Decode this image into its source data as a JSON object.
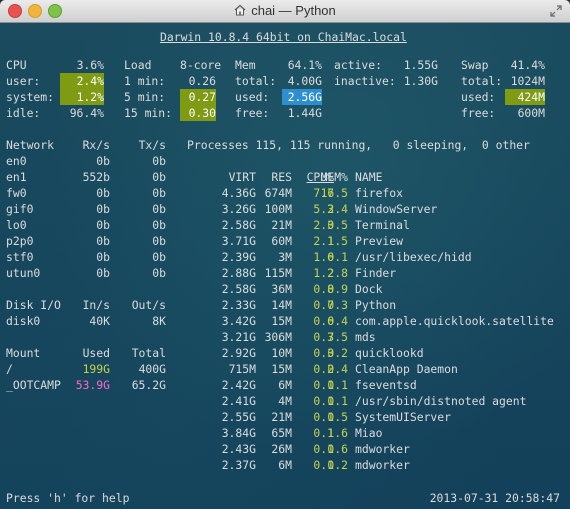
{
  "window": {
    "title": "chai — Python"
  },
  "header": {
    "host": "Darwin 10.8.4 64bit on ChaiMac.local"
  },
  "cpu": {
    "label": "CPU",
    "total": "3.6%",
    "user_label": "user:",
    "user": "2.4%",
    "system_label": "system:",
    "system": "1.2%",
    "idle_label": "idle:",
    "idle": "96.4%"
  },
  "load": {
    "label": "Load",
    "cores": "8-core",
    "m1_label": "1 min:",
    "m1": "0.26",
    "m5_label": "5 min:",
    "m5": "0.27",
    "m15_label": "15 min:",
    "m15": "0.30"
  },
  "mem": {
    "label": "Mem",
    "percent": "64.1%",
    "total_label": "total:",
    "total": "4.00G",
    "used_label": "used:",
    "used": "2.56G",
    "free_label": "free:",
    "free": "1.44G",
    "active_label": "active:",
    "active": "1.55G",
    "inactive_label": "inactive:",
    "inactive": "1.30G"
  },
  "swap": {
    "label": "Swap",
    "percent": "41.4%",
    "total_label": "total:",
    "total": "1024M",
    "used_label": "used:",
    "used": "424M",
    "free_label": "free:",
    "free": "600M"
  },
  "network": {
    "headers": [
      "Network",
      "Rx/s",
      "Tx/s"
    ],
    "rows": [
      [
        "en0",
        "0b",
        "0b"
      ],
      [
        "en1",
        "552b",
        "0b"
      ],
      [
        "fw0",
        "0b",
        "0b"
      ],
      [
        "gif0",
        "0b",
        "0b"
      ],
      [
        "lo0",
        "0b",
        "0b"
      ],
      [
        "p2p0",
        "0b",
        "0b"
      ],
      [
        "stf0",
        "0b",
        "0b"
      ],
      [
        "utun0",
        "0b",
        "0b"
      ]
    ]
  },
  "diskio": {
    "headers": [
      "Disk I/O",
      "In/s",
      "Out/s"
    ],
    "rows": [
      [
        "disk0",
        "40K",
        "8K"
      ]
    ]
  },
  "mounts": {
    "headers": [
      "Mount",
      "Used",
      "Total"
    ],
    "rows": [
      [
        "/",
        "199G",
        "400G"
      ],
      [
        "_OOTCAMP",
        "53.9G",
        "65.2G"
      ]
    ]
  },
  "processes": {
    "summary": "Processes 115, 115 running,   0 sleeping,  0 other",
    "headers": [
      "VIRT",
      "RES",
      "CPU%",
      "MEM%",
      "NAME"
    ],
    "rows": [
      [
        "4.36G",
        "674M",
        "7.7",
        "16.5",
        "firefox"
      ],
      [
        "3.26G",
        "100M",
        "5.3",
        "2.4",
        "WindowServer"
      ],
      [
        "2.58G",
        "21M",
        "2.3",
        "0.5",
        "Terminal"
      ],
      [
        "3.71G",
        "60M",
        "2.1",
        "1.5",
        "Preview"
      ],
      [
        "2.39G",
        "3M",
        "1.6",
        "0.1",
        "/usr/libexec/hidd"
      ],
      [
        "2.88G",
        "115M",
        "1.2",
        "2.8",
        "Finder"
      ],
      [
        "2.58G",
        "36M",
        "0.8",
        "0.9",
        "Dock"
      ],
      [
        "2.33G",
        "14M",
        "0.7",
        "0.3",
        "Python"
      ],
      [
        "3.42G",
        "15M",
        "0.6",
        "0.4",
        "com.apple.quicklook.satellite"
      ],
      [
        "3.21G",
        "306M",
        "0.3",
        "7.5",
        "mds"
      ],
      [
        "2.92G",
        "10M",
        "0.3",
        "0.2",
        "quicklookd"
      ],
      [
        "715M",
        "15M",
        "0.2",
        "0.4",
        "CleanApp Daemon"
      ],
      [
        "2.42G",
        "6M",
        "0.1",
        "0.1",
        "fseventsd"
      ],
      [
        "2.41G",
        "4M",
        "0.1",
        "0.1",
        "/usr/sbin/distnoted agent"
      ],
      [
        "2.55G",
        "21M",
        "0.1",
        "0.5",
        "SystemUIServer"
      ],
      [
        "3.84G",
        "65M",
        "0.1",
        "1.6",
        "Miao"
      ],
      [
        "2.43G",
        "26M",
        "0.1",
        "0.6",
        "mdworker"
      ],
      [
        "2.37G",
        "6M",
        "0.1",
        "0.2",
        "mdworker"
      ]
    ]
  },
  "footer": {
    "help": "Press 'h' for help",
    "datetime": "2013-07-31 20:58:47"
  },
  "colors": {
    "highlight_green": "#7f9b14",
    "highlight_blue": "#2e8fd0",
    "value_green": "#c7d44a",
    "value_magenta": "#ff66cc"
  }
}
